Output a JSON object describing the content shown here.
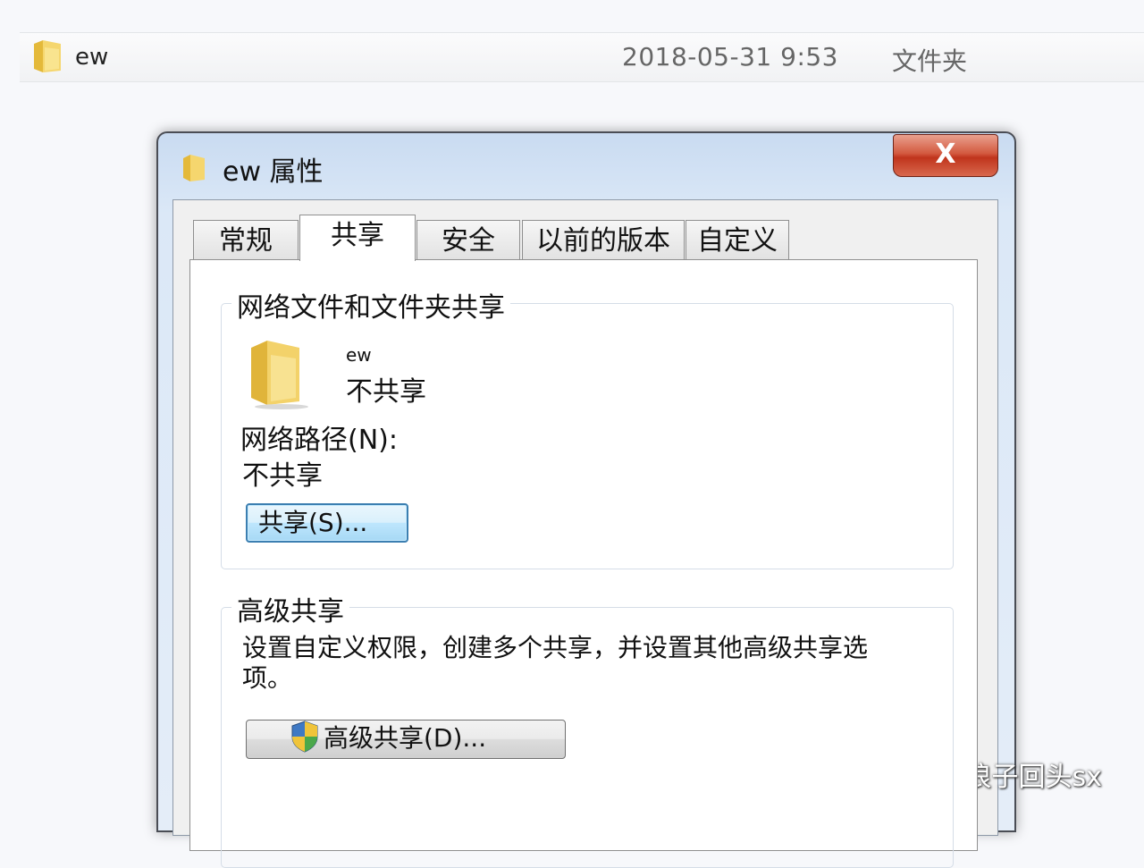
{
  "explorer_row": {
    "name": "ew",
    "date_modified": "2018-05-31 9:53",
    "type": "文件夹"
  },
  "dialog": {
    "title": "ew 属性",
    "close_label": "X",
    "tabs": [
      {
        "label": "常规",
        "active": false
      },
      {
        "label": "共享",
        "active": true
      },
      {
        "label": "安全",
        "active": false
      },
      {
        "label": "以前的版本",
        "active": false
      },
      {
        "label": "自定义",
        "active": false
      }
    ],
    "network_sharing": {
      "title": "网络文件和文件夹共享",
      "folder_name": "ew",
      "share_status": "不共享",
      "network_path_label": "网络路径(N):",
      "network_path_value": "不共享",
      "share_button": "共享(S)..."
    },
    "advanced_sharing": {
      "title": "高级共享",
      "description_line1": "设置自定义权限，创建多个共享，并设置其他高级共享选",
      "description_line2": "项。",
      "button": "高级共享(D)..."
    }
  },
  "watermark": "头条 @浪子回头sx",
  "icons": {
    "folder": "folder-icon",
    "shield": "shield-icon",
    "close": "close-icon"
  }
}
